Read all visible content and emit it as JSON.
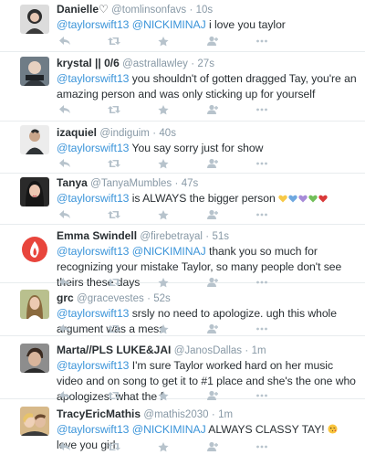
{
  "tweets": [
    {
      "name": "Danielle♡",
      "handle": "@tomlinsonfavs",
      "time": "10s",
      "segments": [
        {
          "text": "@taylorswift13 @NICKIMINAJ",
          "mention": true
        },
        {
          "text": " i love you taylor",
          "mention": false
        }
      ],
      "avatar_color": "#3a3a3a"
    },
    {
      "name": "krystal || 0/6",
      "handle": "@astrallawley",
      "time": "27s",
      "segments": [
        {
          "text": "@taylorswift13",
          "mention": true
        },
        {
          "text": " you shouldn't of gotten dragged Tay, you're an amazing person and was only sticking up for yourself",
          "mention": false
        }
      ],
      "avatar_color": "#5a6670"
    },
    {
      "name": "izaquiel",
      "handle": "@indiguim",
      "time": "40s",
      "segments": [
        {
          "text": "@taylorswift13",
          "mention": true
        },
        {
          "text": " You say sorry just for show",
          "mention": false
        }
      ],
      "avatar_color": "#d8d8d8"
    },
    {
      "name": "Tanya",
      "handle": "@TanyaMumbles",
      "time": "47s",
      "segments": [
        {
          "text": "@taylorswift13",
          "mention": true
        },
        {
          "text": " is ALWAYS the bigger person",
          "mention": false
        }
      ],
      "hearts": [
        "#f7c948",
        "#6fa8e0",
        "#a78bd8",
        "#72bf5a",
        "#d93a3a"
      ],
      "avatar_color": "#2b2b2b"
    },
    {
      "name": "Emma Swindell",
      "handle": "@firebetrayal",
      "time": "51s",
      "segments": [
        {
          "text": "@taylorswift13 @NICKIMINAJ",
          "mention": true
        },
        {
          "text": " thank you so much for recognizing your mistake Taylor, so many people don't see theirs these days",
          "mention": false
        }
      ],
      "avatar_color": "#e8edf2"
    },
    {
      "name": "grc",
      "handle": "@gracevestes",
      "time": "52s",
      "segments": [
        {
          "text": "@taylorswift13",
          "mention": true
        },
        {
          "text": " srsly no need to apologize. ugh this whole argument was a mess",
          "mention": false
        }
      ],
      "avatar_color": "#9aa37a"
    },
    {
      "name": "Marta//PLS LUKE&JAI",
      "handle": "@JanosDallas",
      "time": "1m",
      "segments": [
        {
          "text": "@taylorswift13",
          "mention": true
        },
        {
          "text": " I'm sure Taylor worked hard on her music video and on song to get it to #1 place and she's the one who apologizes. what the f",
          "mention": false
        }
      ],
      "avatar_color": "#4a4a4a"
    },
    {
      "name": "TracyEricMathis",
      "handle": "@mathis2030",
      "time": "1m",
      "segments": [
        {
          "text": "@taylorswift13 @NICKIMINAJ",
          "mention": true
        },
        {
          "text": " ALWAYS CLASSY TAY! ",
          "mention": false
        }
      ],
      "emoji_after": "kiss-face",
      "segments_after": [
        {
          "text": " love you girl",
          "mention": false
        }
      ],
      "avatar_color": "#c7a46a"
    }
  ],
  "dot": "·",
  "colors": {
    "mention": "#3b94d9",
    "meta": "#8899a6",
    "action_icon": "#b7c3cc",
    "divider": "#e8ecee"
  },
  "action_icons": [
    "reply-icon",
    "retweet-icon",
    "favorite-icon",
    "follow-icon",
    "more-icon"
  ]
}
